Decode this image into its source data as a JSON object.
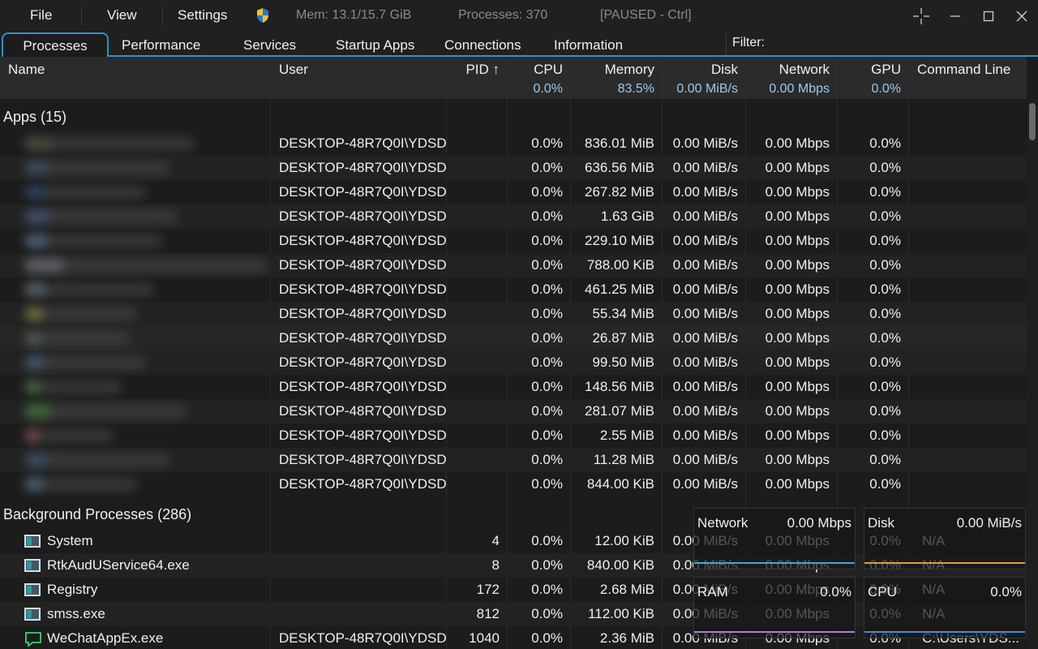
{
  "menu": {
    "file": "File",
    "view": "View",
    "settings": "Settings"
  },
  "status": {
    "mem": "Mem: 13.1/15.7 GiB",
    "processes": "Processes: 370",
    "paused": "[PAUSED - Ctrl]"
  },
  "tabs": [
    "Processes",
    "Performance",
    "Services",
    "Startup Apps",
    "Connections",
    "Information"
  ],
  "filter": {
    "label": "Filter:",
    "value": ""
  },
  "columns": {
    "name": "Name",
    "user": "User",
    "pid": "PID ↑",
    "cpu": "CPU",
    "memory": "Memory",
    "disk": "Disk",
    "network": "Network",
    "gpu": "GPU",
    "command": "Command Line",
    "cpu_total": "0.0%",
    "memory_total": "83.5%",
    "disk_total": "0.00 MiB/s",
    "network_total": "0.00 Mbps",
    "gpu_total": "0.0%"
  },
  "apps_group": "Apps (15)",
  "apps": [
    {
      "user": "DESKTOP-48R7Q0I\\YDSD",
      "cpu": "0.0%",
      "memory": "836.01 MiB",
      "disk": "0.00 MiB/s",
      "network": "0.00 Mbps",
      "gpu": "0.0%"
    },
    {
      "user": "DESKTOP-48R7Q0I\\YDSD",
      "cpu": "0.0%",
      "memory": "636.56 MiB",
      "disk": "0.00 MiB/s",
      "network": "0.00 Mbps",
      "gpu": "0.0%"
    },
    {
      "user": "DESKTOP-48R7Q0I\\YDSD",
      "cpu": "0.0%",
      "memory": "267.82 MiB",
      "disk": "0.00 MiB/s",
      "network": "0.00 Mbps",
      "gpu": "0.0%"
    },
    {
      "user": "DESKTOP-48R7Q0I\\YDSD",
      "cpu": "0.0%",
      "memory": "1.63 GiB",
      "disk": "0.00 MiB/s",
      "network": "0.00 Mbps",
      "gpu": "0.0%"
    },
    {
      "user": "DESKTOP-48R7Q0I\\YDSD",
      "cpu": "0.0%",
      "memory": "229.10 MiB",
      "disk": "0.00 MiB/s",
      "network": "0.00 Mbps",
      "gpu": "0.0%"
    },
    {
      "user": "DESKTOP-48R7Q0I\\YDSD",
      "cpu": "0.0%",
      "memory": "788.00 KiB",
      "disk": "0.00 MiB/s",
      "network": "0.00 Mbps",
      "gpu": "0.0%"
    },
    {
      "user": "DESKTOP-48R7Q0I\\YDSD",
      "cpu": "0.0%",
      "memory": "461.25 MiB",
      "disk": "0.00 MiB/s",
      "network": "0.00 Mbps",
      "gpu": "0.0%"
    },
    {
      "user": "DESKTOP-48R7Q0I\\YDSD",
      "cpu": "0.0%",
      "memory": "55.34 MiB",
      "disk": "0.00 MiB/s",
      "network": "0.00 Mbps",
      "gpu": "0.0%"
    },
    {
      "user": "DESKTOP-48R7Q0I\\YDSD",
      "cpu": "0.0%",
      "memory": "26.87 MiB",
      "disk": "0.00 MiB/s",
      "network": "0.00 Mbps",
      "gpu": "0.0%"
    },
    {
      "user": "DESKTOP-48R7Q0I\\YDSD",
      "cpu": "0.0%",
      "memory": "99.50 MiB",
      "disk": "0.00 MiB/s",
      "network": "0.00 Mbps",
      "gpu": "0.0%"
    },
    {
      "user": "DESKTOP-48R7Q0I\\YDSD",
      "cpu": "0.0%",
      "memory": "148.56 MiB",
      "disk": "0.00 MiB/s",
      "network": "0.00 Mbps",
      "gpu": "0.0%"
    },
    {
      "user": "DESKTOP-48R7Q0I\\YDSD",
      "cpu": "0.0%",
      "memory": "281.07 MiB",
      "disk": "0.00 MiB/s",
      "network": "0.00 Mbps",
      "gpu": "0.0%"
    },
    {
      "user": "DESKTOP-48R7Q0I\\YDSD",
      "cpu": "0.0%",
      "memory": "2.55 MiB",
      "disk": "0.00 MiB/s",
      "network": "0.00 Mbps",
      "gpu": "0.0%"
    },
    {
      "user": "DESKTOP-48R7Q0I\\YDSD",
      "cpu": "0.0%",
      "memory": "11.28 MiB",
      "disk": "0.00 MiB/s",
      "network": "0.00 Mbps",
      "gpu": "0.0%"
    },
    {
      "user": "DESKTOP-48R7Q0I\\YDSD",
      "cpu": "0.0%",
      "memory": "844.00 KiB",
      "disk": "0.00 MiB/s",
      "network": "0.00 Mbps",
      "gpu": "0.0%"
    }
  ],
  "bg_group": "Background Processes (286)",
  "background": [
    {
      "name": "System",
      "user": "",
      "pid": "4",
      "cpu": "0.0%",
      "memory": "12.00 KiB",
      "disk": "0.00 MiB/s",
      "network": "0.00 Mbps",
      "gpu": "0.0%",
      "command": "N/A",
      "icon": "window-icon"
    },
    {
      "name": "RtkAudUService64.exe",
      "user": "",
      "pid": "8",
      "cpu": "0.0%",
      "memory": "840.00 KiB",
      "disk": "0.00 MiB/s",
      "network": "0.00 Mbps",
      "gpu": "0.0%",
      "command": "N/A",
      "icon": "window-icon"
    },
    {
      "name": "Registry",
      "user": "",
      "pid": "172",
      "cpu": "0.0%",
      "memory": "2.68 MiB",
      "disk": "0.00 MiB/s",
      "network": "0.00 Mbps",
      "gpu": "0.0%",
      "command": "N/A",
      "icon": "window-icon"
    },
    {
      "name": "smss.exe",
      "user": "",
      "pid": "812",
      "cpu": "0.0%",
      "memory": "112.00 KiB",
      "disk": "0.00 MiB/s",
      "network": "0.00 Mbps",
      "gpu": "0.0%",
      "command": "N/A",
      "icon": "window-icon"
    },
    {
      "name": "WeChatAppEx.exe",
      "user": "DESKTOP-48R7Q0I\\YDSD",
      "pid": "1040",
      "cpu": "0.0%",
      "memory": "2.36 MiB",
      "disk": "0.00 MiB/s",
      "network": "0.00 Mbps",
      "gpu": "0.0%",
      "command": "C:\\Users\\YDS...",
      "icon": "chat-icon"
    }
  ],
  "mini_graphs": {
    "network": {
      "label": "Network",
      "value": "0.00 Mbps",
      "color": "#3fa9d8"
    },
    "disk": {
      "label": "Disk",
      "value": "0.00 MiB/s",
      "color": "#d8a13f"
    },
    "ram": {
      "label": "RAM",
      "value": "0.0%",
      "color": "#b07fd8"
    },
    "cpu": {
      "label": "CPU",
      "value": "0.0%",
      "color": "#3f8fd8"
    }
  },
  "colors": {
    "accent": "#2f8fcf",
    "header_bg": "#2b2b2b",
    "value_blue": "#9fc7ea"
  }
}
